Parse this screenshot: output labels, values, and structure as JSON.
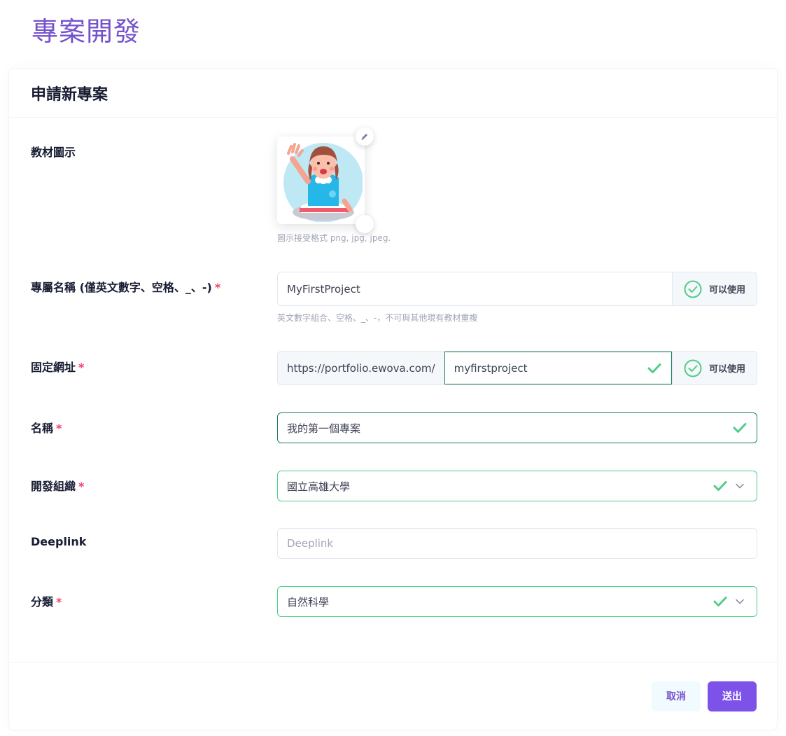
{
  "page": {
    "title": "專案開發"
  },
  "card": {
    "title": "申請新專案"
  },
  "icon_field": {
    "label": "教材圖示",
    "hint": "圖示接受格式 png, jpg, jpeg."
  },
  "slug_field": {
    "label": "專屬名稱 (僅英文數字、空格、_、-)",
    "required": "*",
    "value": "MyFirstProject",
    "status": "可以使用",
    "hint": "英文數字組合、空格、_、-，不可與其他現有教材重複"
  },
  "url_field": {
    "label": "固定網址",
    "required": "*",
    "prefix": "https://portfolio.ewova.com/",
    "value": "myfirstproject",
    "status": "可以使用"
  },
  "name_field": {
    "label": "名稱",
    "required": "*",
    "value": "我的第一個專案"
  },
  "org_field": {
    "label": "開發組織",
    "required": "*",
    "value": "國立高雄大學"
  },
  "deeplink_field": {
    "label": "Deeplink",
    "placeholder": "Deeplink"
  },
  "category_field": {
    "label": "分類",
    "required": "*",
    "value": "自然科學"
  },
  "footer": {
    "cancel_label": "取消",
    "submit_label": "送出"
  },
  "colors": {
    "accent": "#7c52e9",
    "valid": "#50cd89",
    "required": "#f1416c"
  }
}
